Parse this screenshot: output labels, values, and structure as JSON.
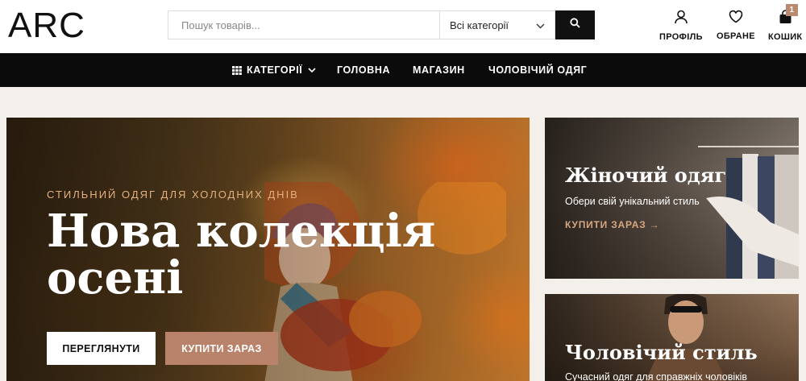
{
  "header": {
    "logo": "ARC",
    "search": {
      "placeholder": "Пошук товарів..."
    },
    "category_select": {
      "value": "Всі категорії"
    },
    "icons": [
      {
        "label": "ПРОФІЛЬ",
        "icon": "user-icon"
      },
      {
        "label": "ОБРАНЕ",
        "icon": "heart-icon"
      },
      {
        "label": "КОШИК",
        "icon": "cart-icon",
        "badge": "1"
      }
    ]
  },
  "nav": {
    "categories_label": "КАТЕГОРІЇ",
    "items": [
      "ГОЛОВНА",
      "МАГАЗИН",
      "ЧОЛОВІЧИЙ ОДЯГ"
    ]
  },
  "hero": {
    "eyebrow": "СТИЛЬНИЙ ОДЯГ ДЛЯ ХОЛОДНИХ ДНІВ",
    "title": "Нова колекція осені",
    "view_button": "ПЕРЕГЛЯНУТИ",
    "buy_button": "КУПИТИ ЗАРАЗ"
  },
  "cards": [
    {
      "title": "Жіночий одяг",
      "subtitle": "Обери свій унікальний стиль",
      "link": "КУПИТИ ЗАРАЗ →"
    },
    {
      "title": "Чоловічий стиль",
      "subtitle": "Сучасний одяг для справжніх чоловіків"
    }
  ],
  "colors": {
    "accent": "#b9826b",
    "nav_bg": "#0b0b0b",
    "page_bg": "#f3f0ec"
  }
}
